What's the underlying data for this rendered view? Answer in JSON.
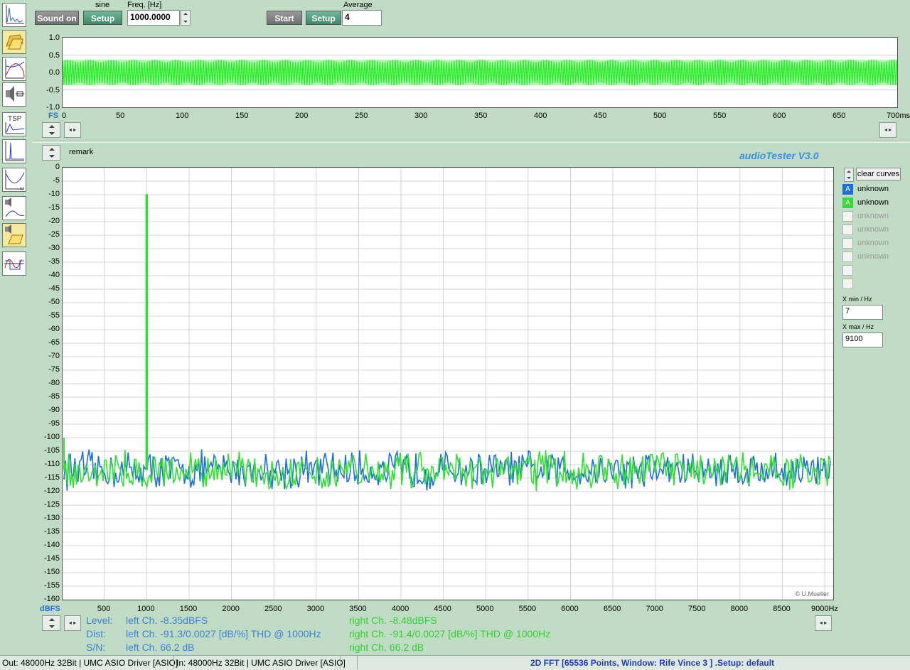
{
  "toolbar": {
    "sound_on": "Sound on",
    "generator_type": "sine",
    "generator_setup": "Setup",
    "freq_label": "Freq. [Hz]",
    "freq_value": "1000.0000",
    "start": "Start",
    "analyzer_setup": "Setup",
    "average_label": "Average",
    "average_value": "4"
  },
  "scope": {
    "y_ticks": [
      "1.0",
      "0.5",
      "0.0",
      "-0.5",
      "-1.0"
    ],
    "y_unit": "FS",
    "x_ticks": [
      "0",
      "50",
      "100",
      "150",
      "200",
      "250",
      "300",
      "350",
      "400",
      "450",
      "500",
      "550",
      "600",
      "650"
    ],
    "x_end": "700ms",
    "signal_color": "#22ee22"
  },
  "fft": {
    "remark": "remark",
    "brand": "audioTester  V3.0",
    "copyright": "© U.Mueller",
    "y_unit": "dBFS",
    "y_ticks": [
      "0",
      "-5",
      "-10",
      "-15",
      "-20",
      "-25",
      "-30",
      "-35",
      "-40",
      "-45",
      "-50",
      "-55",
      "-60",
      "-65",
      "-70",
      "-75",
      "-80",
      "-85",
      "-90",
      "-95",
      "-100",
      "-105",
      "-110",
      "-115",
      "-120",
      "-125",
      "-130",
      "-135",
      "-140",
      "-145",
      "-150",
      "-155",
      "-160"
    ],
    "x_ticks": [
      "500",
      "1000",
      "1500",
      "2000",
      "2500",
      "3000",
      "3500",
      "4000",
      "4500",
      "5000",
      "5500",
      "6000",
      "6500",
      "7000",
      "7500",
      "8000",
      "8500"
    ],
    "x_end": "9000Hz",
    "colors": {
      "left": "#1e6fd9",
      "right": "#2fe02f",
      "grid": "#c8c8c8"
    }
  },
  "chart_data": {
    "type": "line",
    "title": "",
    "xlabel": "",
    "ylabel": "dBFS",
    "xlim": [
      7,
      9100
    ],
    "ylim": [
      -160,
      0
    ],
    "series": [
      {
        "name": "left Ch.",
        "peak_hz": 1000,
        "peak_db": -9.8,
        "noise_floor_db": -112
      },
      {
        "name": "right Ch.",
        "peak_hz": 1000,
        "peak_db": -9.8,
        "noise_floor_db": -112
      }
    ]
  },
  "legend": {
    "clear": "clear curves",
    "items": [
      {
        "mark": "A",
        "label": "unknown",
        "state": "blue"
      },
      {
        "mark": "A",
        "label": "unknown",
        "state": "green"
      },
      {
        "mark": "",
        "label": "unknown",
        "state": "off"
      },
      {
        "mark": "",
        "label": "unknown",
        "state": "off"
      },
      {
        "mark": "",
        "label": "unknown",
        "state": "off"
      },
      {
        "mark": "",
        "label": "unknown",
        "state": "off"
      },
      {
        "mark": "",
        "label": "",
        "state": "off"
      },
      {
        "mark": "",
        "label": "",
        "state": "off"
      }
    ],
    "xmin_label": "X min / Hz",
    "xmin_value": "7",
    "xmax_label": "X max / Hz",
    "xmax_value": "9100"
  },
  "stats": {
    "level_label": "Level:",
    "dist_label": "Dist:",
    "sn_label": "S/N:",
    "left_level": "left Ch. -8.35dBFS",
    "left_dist": "left Ch. -91.3/0.0027 [dB/%] THD @ 1000Hz",
    "left_sn": "left Ch. 66.2 dB",
    "right_level": "right Ch. -8.48dBFS",
    "right_dist": "right Ch. -91.4/0.0027 [dB/%] THD @ 1000Hz",
    "right_sn": "right Ch. 66.2 dB"
  },
  "status": {
    "out": "Out: 48000Hz 32Bit  | UMC ASIO Driver [ASIO]",
    "in": "In: 48000Hz 32Bit  | UMC ASIO Driver [ASIO]",
    "mode": "2D FFT [65536 Points, Window: Rife Vince 3 ]  .Setup:  default"
  }
}
